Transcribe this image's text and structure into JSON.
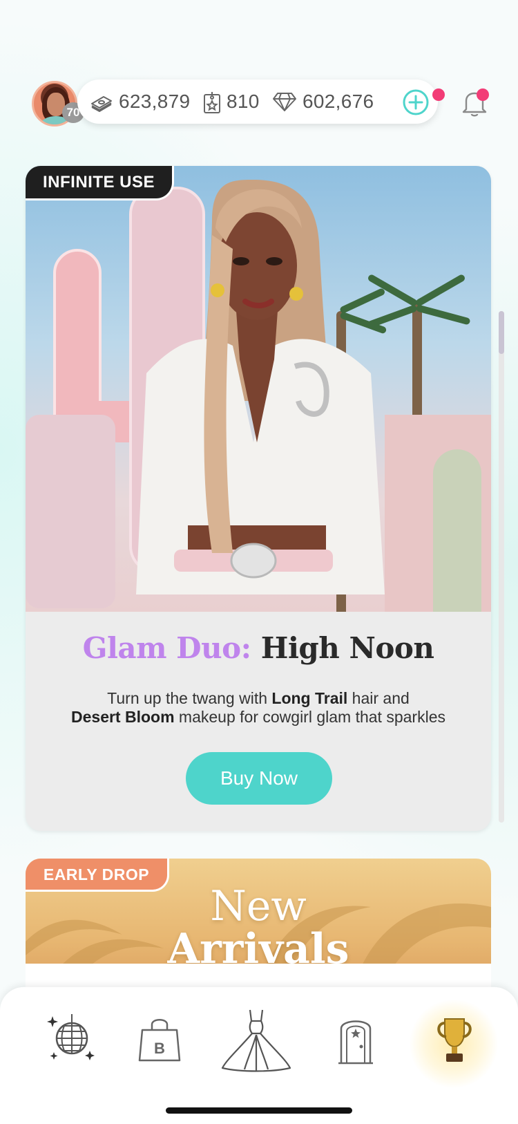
{
  "header": {
    "level": "70",
    "cash": "623,879",
    "tickets": "810",
    "gems": "602,676",
    "colors": {
      "accent": "#4ed4cb",
      "notification": "#f23c76"
    }
  },
  "promo": {
    "tag": "INFINITE USE",
    "title_highlight": "Glam Duo:",
    "title_rest": " High Noon",
    "desc_1": "Turn up the twang with ",
    "desc_bold_1": "Long Trail",
    "desc_2": " hair and",
    "desc_bold_2": "Desert Bloom",
    "desc_3": " makeup for cowgirl glam that sparkles",
    "button": "Buy Now",
    "colors": {
      "title_highlight": "#bf84ec",
      "button": "#4ed4cb"
    }
  },
  "second_card": {
    "tag": "EARLY DROP",
    "title_1": "New",
    "title_2": "Arrivals",
    "colors": {
      "tag": "#ef8f68"
    }
  },
  "bottom_nav": {
    "items": [
      {
        "icon": "disco-ball-icon"
      },
      {
        "icon": "shopping-bag-icon",
        "letter": "B"
      },
      {
        "icon": "gown-icon"
      },
      {
        "icon": "door-star-icon"
      },
      {
        "icon": "trophy-icon"
      }
    ]
  }
}
